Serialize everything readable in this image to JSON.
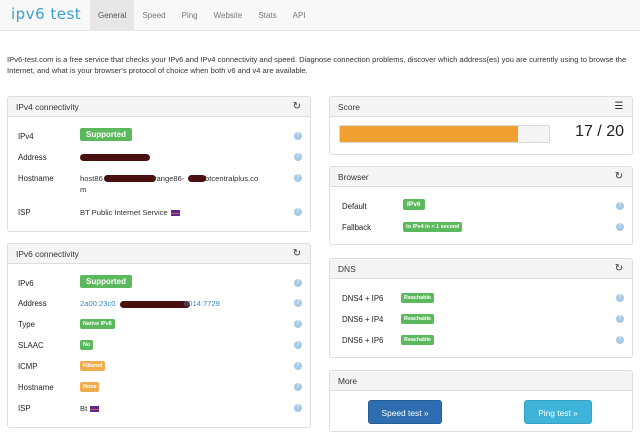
{
  "nav": {
    "brand": "ipv6 test",
    "tabs": [
      "General",
      "Speed",
      "Ping",
      "Website",
      "Stats",
      "API"
    ]
  },
  "intro": "IPv6-test.com is a free service that checks your IPv6 and IPv4 connectivity and speed. Diagnose connection problems, discover which address(es) you are currently using to browse the Internet, and what is your browser's protocol of choice when both v6 and v4 are available.",
  "ipv4": {
    "title": "IPv4 connectivity",
    "rows": [
      {
        "label": "IPv4",
        "value": "Supported"
      },
      {
        "label": "Address",
        "value": ""
      },
      {
        "label": "Hostname",
        "value_a": "host86",
        "value_b": "range86-",
        "value_c": "btcentralplus.co",
        "value_d": "m"
      },
      {
        "label": "ISP",
        "value": "BT Public Internet Service"
      }
    ]
  },
  "ipv6": {
    "title": "IPv6 connectivity",
    "rows": [
      {
        "label": "IPv6",
        "value": "Supported"
      },
      {
        "label": "Address",
        "value_a": "2a00:23c0",
        "value_b": "6014:7729"
      },
      {
        "label": "Type",
        "value": "Native IPv6"
      },
      {
        "label": "SLAAC",
        "value": "No"
      },
      {
        "label": "ICMP",
        "value": "Filtered"
      },
      {
        "label": "Hostname",
        "value": "None"
      },
      {
        "label": "ISP",
        "value": "Bt"
      }
    ]
  },
  "score": {
    "title": "Score",
    "value": "17 / 20",
    "fraction": 0.85
  },
  "browser": {
    "title": "Browser",
    "rows": [
      {
        "label": "Default",
        "value": "IPv6"
      },
      {
        "label": "Fallback",
        "value": "to IPv4 in < 1 second"
      }
    ]
  },
  "dns": {
    "title": "DNS",
    "rows": [
      {
        "label": "DNS4 + IP6",
        "value": "Reachable"
      },
      {
        "label": "DNS6 + IP4",
        "value": "Reachable"
      },
      {
        "label": "DNS6 + IP6",
        "value": "Reachable"
      }
    ]
  },
  "more": {
    "title": "More",
    "speed_button": "Speed test »",
    "ping_button": "Ping test »"
  },
  "icons": {
    "refresh": "refresh-icon",
    "list": "list-icon",
    "help": "help-icon",
    "flag": "uk-flag-icon"
  },
  "colors": {
    "success": "#5cb85c",
    "warning": "#f0ad4e",
    "score_bar": "#f0a030",
    "primary_button": "#2e6eb0",
    "info_button": "#3fb4da",
    "brand": "#3aa0d0"
  }
}
